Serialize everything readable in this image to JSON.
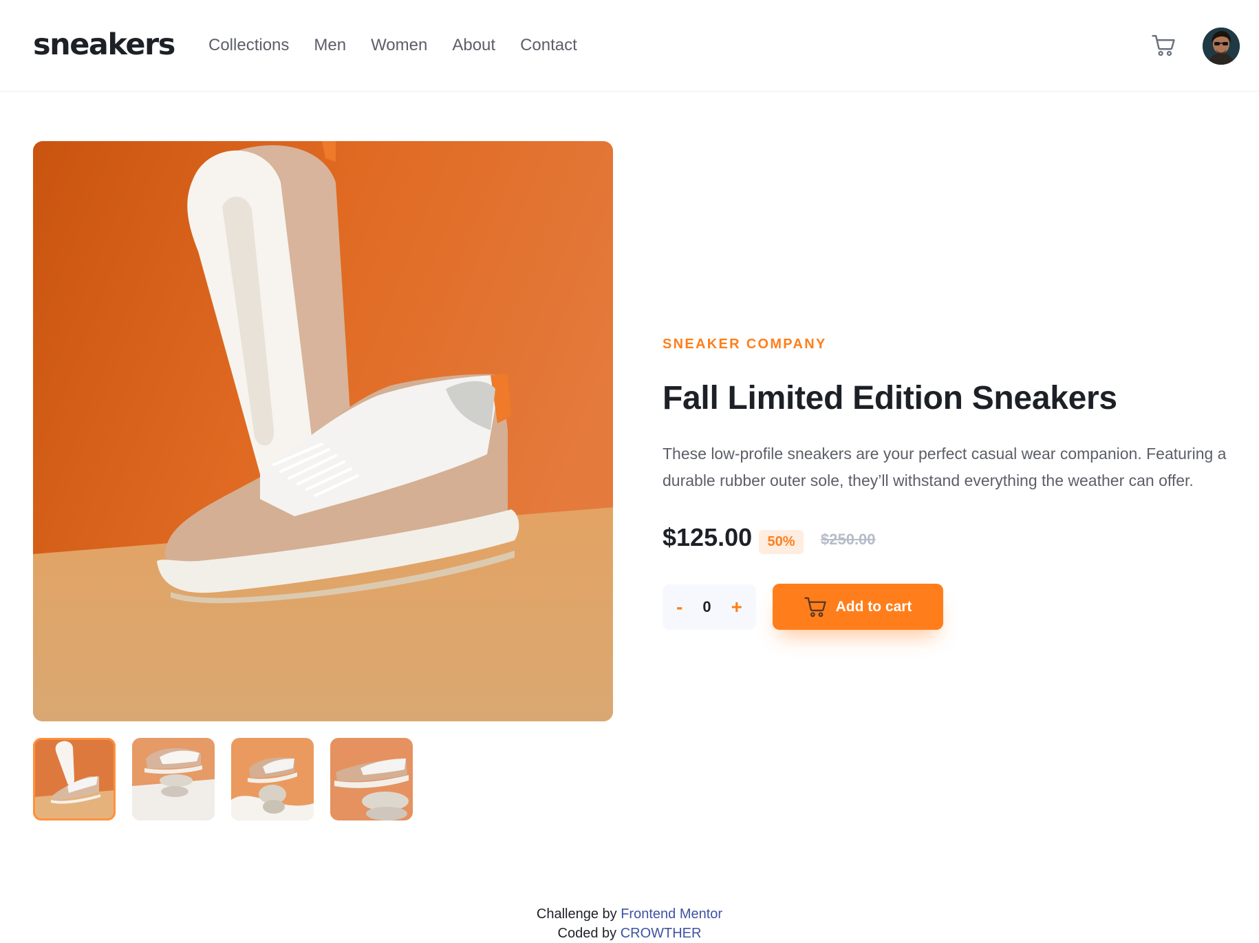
{
  "header": {
    "logo": "sneakers",
    "nav": [
      "Collections",
      "Men",
      "Women",
      "About",
      "Contact"
    ],
    "cart_icon": "cart-icon",
    "avatar_icon": "avatar"
  },
  "gallery": {
    "thumbnail_count": 4,
    "active_thumbnail": 1
  },
  "product": {
    "company": "SNEAKER COMPANY",
    "title": "Fall Limited Edition Sneakers",
    "description": "These low-profile sneakers are your perfect casual wear companion. Featuring a durable rubber outer sole, they’ll withstand everything the weather can offer.",
    "price": "$125.00",
    "discount": "50%",
    "original_price": "$250.00"
  },
  "cart_controls": {
    "minus": "-",
    "quantity": "0",
    "plus": "+",
    "add_label": "Add to cart"
  },
  "footer": {
    "challenge_prefix": "Challenge by",
    "challenge_link": "Frontend Mentor",
    "coded_prefix": "Coded by",
    "coded_link": "CROWTHER"
  },
  "colors": {
    "accent": "#ff7e1b",
    "accent_pale": "#ffede0",
    "text_dark": "#1d2026",
    "text_gray": "#5c5e68",
    "link": "#3e52a3"
  }
}
